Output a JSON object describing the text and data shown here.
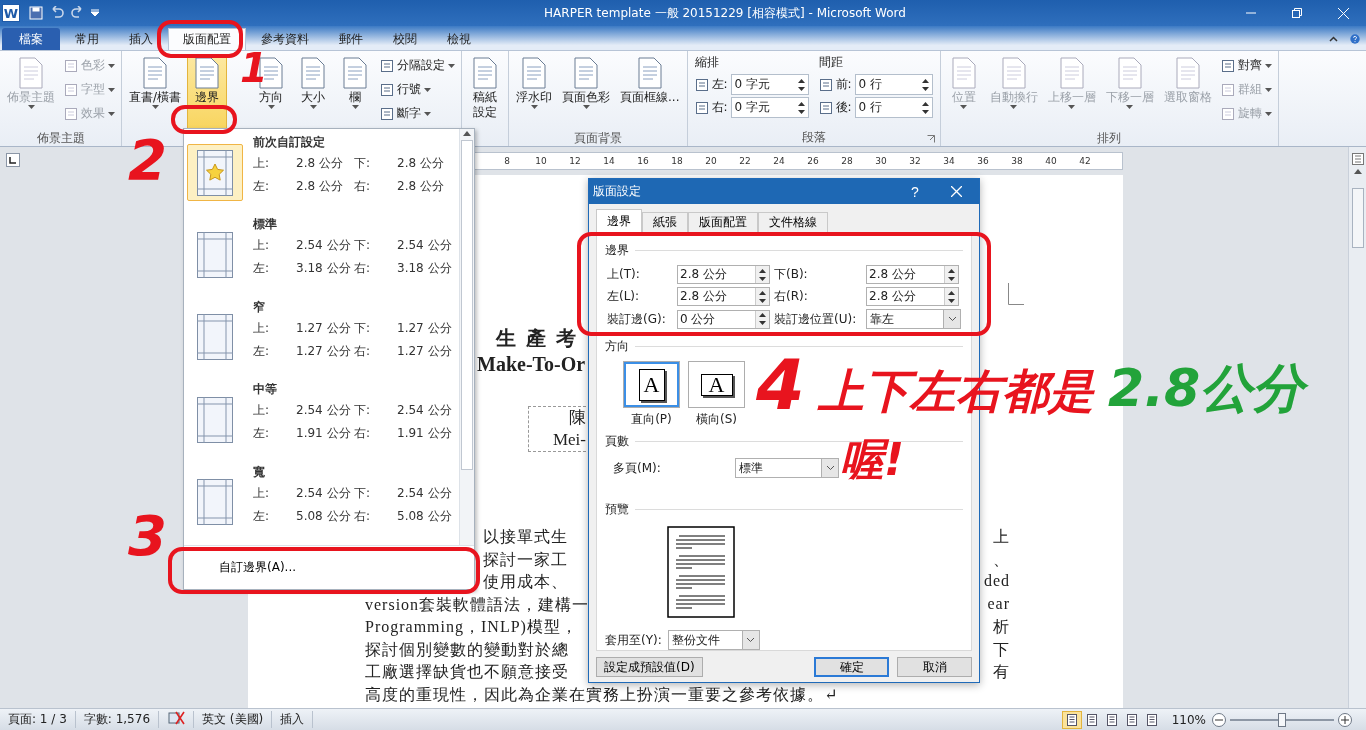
{
  "title_bar": {
    "logo": "W",
    "title": "HARPER template 一般 20151229 [相容模式] - Microsoft Word"
  },
  "tabs": [
    {
      "label": "檔案",
      "kind": "file",
      "selected": false
    },
    {
      "label": "常用",
      "kind": "tab",
      "selected": false
    },
    {
      "label": "插入",
      "kind": "tab",
      "selected": false
    },
    {
      "label": "版面配置",
      "kind": "tab",
      "selected": true
    },
    {
      "label": "參考資料",
      "kind": "tab",
      "selected": false
    },
    {
      "label": "郵件",
      "kind": "tab",
      "selected": false
    },
    {
      "label": "校閱",
      "kind": "tab",
      "selected": false
    },
    {
      "label": "檢視",
      "kind": "tab",
      "selected": false
    }
  ],
  "ribbon": {
    "groups": [
      {
        "label": "佈景主題",
        "launcher": false,
        "columns": [
          [
            {
              "kind": "large",
              "label": "佈景主題",
              "disabled": true,
              "menu": true,
              "active": false
            }
          ],
          [
            {
              "kind": "small",
              "label": "色彩",
              "disabled": true,
              "menu": true
            },
            {
              "kind": "small",
              "label": "字型",
              "disabled": true,
              "menu": true
            },
            {
              "kind": "small",
              "label": "效果",
              "disabled": true,
              "menu": true
            }
          ]
        ]
      },
      {
        "launcher": false,
        "columns": [
          [
            {
              "kind": "large",
              "label": "直書/橫書",
              "disabled": false,
              "menu": true,
              "active": false
            }
          ],
          [
            {
              "kind": "large",
              "label": "邊界",
              "disabled": false,
              "menu": true,
              "active": true
            }
          ],
          [
            {
              "kind": "large",
              "label": "方向",
              "disabled": false,
              "menu": true,
              "active": false
            }
          ],
          [
            {
              "kind": "large",
              "label": "大小",
              "disabled": false,
              "menu": true,
              "active": false
            }
          ],
          [
            {
              "kind": "large",
              "label": "欄",
              "disabled": false,
              "menu": true,
              "active": false
            }
          ],
          [
            {
              "kind": "small",
              "label": "分隔設定",
              "disabled": false,
              "menu": true
            },
            {
              "kind": "small",
              "label": "行號",
              "disabled": false,
              "menu": true
            },
            {
              "kind": "small",
              "label": "斷字",
              "disabled": false,
              "menu": true
            }
          ]
        ]
      },
      {
        "launcher": false,
        "columns": [
          [
            {
              "kind": "large",
              "lines": [
                "稿紙",
                "設定"
              ],
              "disabled": false,
              "menu": false,
              "active": false
            }
          ]
        ]
      },
      {
        "label": "頁面背景",
        "launcher": false,
        "columns": [
          [
            {
              "kind": "large",
              "label": "浮水印",
              "disabled": false,
              "menu": true,
              "active": false
            }
          ],
          [
            {
              "kind": "large",
              "label": "頁面色彩",
              "disabled": false,
              "menu": true,
              "active": false
            }
          ],
          [
            {
              "kind": "large",
              "label": "頁面框線...",
              "disabled": false,
              "menu": false,
              "active": false
            }
          ]
        ]
      },
      {
        "label": "段落",
        "launcher": true,
        "columns": [
          [
            {
              "kind": "spin",
              "title": "縮排",
              "rows": [
                {
                  "label": "左:",
                  "value": "0 字元"
                },
                {
                  "label": "右:",
                  "value": "0 字元"
                }
              ]
            }
          ],
          [
            {
              "kind": "spin",
              "title": "間距",
              "rows": [
                {
                  "label": "前:",
                  "value": "0 行"
                },
                {
                  "label": "後:",
                  "value": "0 行"
                }
              ]
            }
          ]
        ]
      },
      {
        "label": "排列",
        "launcher": false,
        "columns": [
          [
            {
              "kind": "large",
              "label": "位置",
              "disabled": true,
              "menu": true,
              "active": false
            }
          ],
          [
            {
              "kind": "large",
              "label": "自動換行",
              "disabled": true,
              "menu": true,
              "active": false
            }
          ],
          [
            {
              "kind": "large",
              "label": "上移一層",
              "disabled": true,
              "menu": true,
              "active": false
            }
          ],
          [
            {
              "kind": "large",
              "label": "下移一層",
              "disabled": true,
              "menu": true,
              "active": false
            }
          ],
          [
            {
              "kind": "large",
              "label": "選取窗格",
              "disabled": true,
              "menu": false,
              "active": false
            }
          ],
          [
            {
              "kind": "small",
              "label": "對齊",
              "disabled": false,
              "menu": true
            },
            {
              "kind": "small",
              "label": "群組",
              "disabled": true,
              "menu": true
            },
            {
              "kind": "small",
              "label": "旋轉",
              "disabled": true,
              "menu": true
            }
          ]
        ]
      }
    ]
  },
  "document": {
    "ruler": [
      "8",
      "10",
      "12",
      "14",
      "16",
      "18",
      "20",
      "22",
      "24",
      "26",
      "28",
      "30",
      "32",
      "34",
      "36",
      "38",
      "40",
      "42"
    ],
    "title_fragment": "生產考",
    "subtitle_fragment": "Make-To-Or",
    "author_fragments": [
      "陳",
      "Mei-"
    ],
    "lines": [
      {
        "left": "以接單式生",
        "right": "上",
        "lead_hidden": true
      },
      {
        "left": "探討一家工",
        "right": "、",
        "lead_hidden": true
      },
      {
        "left": "使用成本、",
        "right": "ded",
        "lead_hidden": true
      },
      {
        "left": "version套裝軟體語法，建構一",
        "right": "ear",
        "lead_hidden": false
      },
      {
        "left": "Programming，INLP)模型，",
        "right": "析",
        "lead_hidden": false
      },
      {
        "left": "探討個別變數的變動對於總",
        "right": "下",
        "lead_hidden": false
      },
      {
        "left": "工廠選擇缺貨也不願意接受",
        "right": "有",
        "lead_hidden": false
      },
      {
        "left": "高度的重現性，因此為企業在實務上扮演一重要之參考依據。↵",
        "lead_hidden": false
      }
    ]
  },
  "margins_menu": {
    "items": [
      {
        "kind": "custom",
        "name": "前次自訂設定",
        "selected": true,
        "values": [
          {
            "label": "上:",
            "value": "2.8 公分"
          },
          {
            "label": "下:",
            "value": "2.8 公分"
          },
          {
            "label": "左:",
            "value": "2.8 公分"
          },
          {
            "label": "右:",
            "value": "2.8 公分"
          }
        ]
      },
      {
        "kind": "preset",
        "name": "標準",
        "selected": false,
        "values": [
          {
            "label": "上:",
            "value": "2.54 公分"
          },
          {
            "label": "下:",
            "value": "2.54 公分"
          },
          {
            "label": "左:",
            "value": "3.18 公分"
          },
          {
            "label": "右:",
            "value": "3.18 公分"
          }
        ]
      },
      {
        "kind": "preset",
        "name": "窄",
        "selected": false,
        "values": [
          {
            "label": "上:",
            "value": "1.27 公分"
          },
          {
            "label": "下:",
            "value": "1.27 公分"
          },
          {
            "label": "左:",
            "value": "1.27 公分"
          },
          {
            "label": "右:",
            "value": "1.27 公分"
          }
        ]
      },
      {
        "kind": "preset",
        "name": "中等",
        "selected": false,
        "values": [
          {
            "label": "上:",
            "value": "2.54 公分"
          },
          {
            "label": "下:",
            "value": "2.54 公分"
          },
          {
            "label": "左:",
            "value": "1.91 公分"
          },
          {
            "label": "右:",
            "value": "1.91 公分"
          }
        ]
      },
      {
        "kind": "preset",
        "name": "寬",
        "selected": false,
        "values": [
          {
            "label": "上:",
            "value": "2.54 公分"
          },
          {
            "label": "下:",
            "value": "2.54 公分"
          },
          {
            "label": "左:",
            "value": "5.08 公分"
          },
          {
            "label": "右:",
            "value": "5.08 公分"
          }
        ]
      }
    ],
    "footer": "自訂邊界(A)..."
  },
  "page_setup_dialog": {
    "title": "版面設定",
    "help": "?",
    "tabs": [
      {
        "label": "邊界",
        "selected": true
      },
      {
        "label": "紙張",
        "selected": false
      },
      {
        "label": "版面配置",
        "selected": false
      },
      {
        "label": "文件格線",
        "selected": false
      }
    ],
    "margins": {
      "heading": "邊界",
      "fields": [
        {
          "kind": "spin",
          "label": "上(T):",
          "value": "2.8 公分"
        },
        {
          "kind": "spin",
          "label": "下(B):",
          "value": "2.8 公分"
        },
        {
          "kind": "spin",
          "label": "左(L):",
          "value": "2.8 公分"
        },
        {
          "kind": "spin",
          "label": "右(R):",
          "value": "2.8 公分"
        },
        {
          "kind": "spin",
          "label": "裝訂邊(G):",
          "value": "0 公分"
        },
        {
          "kind": "select",
          "label": "裝訂邊位置(U):",
          "value": "靠左"
        }
      ]
    },
    "orientation": {
      "heading": "方向",
      "options": [
        {
          "label": "直向(P)",
          "glyph": "A",
          "selected": true
        },
        {
          "label": "橫向(S)",
          "glyph": "A",
          "selected": false
        }
      ]
    },
    "pages": {
      "heading": "頁數",
      "label": "多頁(M):",
      "value": "標準"
    },
    "preview": {
      "heading": "預覽",
      "apply_label": "套用至(Y):",
      "apply_value": "整份文件"
    },
    "buttons": [
      {
        "label": "設定成預設值(D)",
        "default": false
      },
      {
        "label": "確定",
        "default": true
      },
      {
        "label": "取消",
        "default": false
      }
    ]
  },
  "annotations": [
    {
      "text": "1",
      "color": "#e8141e"
    },
    {
      "text": "2",
      "color": "#e8141e"
    },
    {
      "text": "3",
      "color": "#e8141e"
    },
    {
      "text": "4",
      "color": "#e8141e"
    },
    {
      "text": "上下左右都是",
      "color": "#e8141e"
    },
    {
      "text": "2.8公分",
      "color": "#22a33a"
    },
    {
      "text": "喔!",
      "color": "#e8141e"
    }
  ],
  "status_bar": {
    "items": [
      {
        "kind": "text",
        "text": "頁面: 1 / 3"
      },
      {
        "kind": "text",
        "text": "字數: 1,576"
      },
      {
        "kind": "proofing"
      },
      {
        "kind": "text",
        "text": "英文 (美國)"
      },
      {
        "kind": "text",
        "text": "插入"
      }
    ],
    "views": [
      {
        "selected": true
      },
      {
        "selected": false
      },
      {
        "selected": false
      },
      {
        "selected": false
      },
      {
        "selected": false
      }
    ],
    "zoom": "110%",
    "zoom_slider": {
      "level": 0.5
    }
  }
}
